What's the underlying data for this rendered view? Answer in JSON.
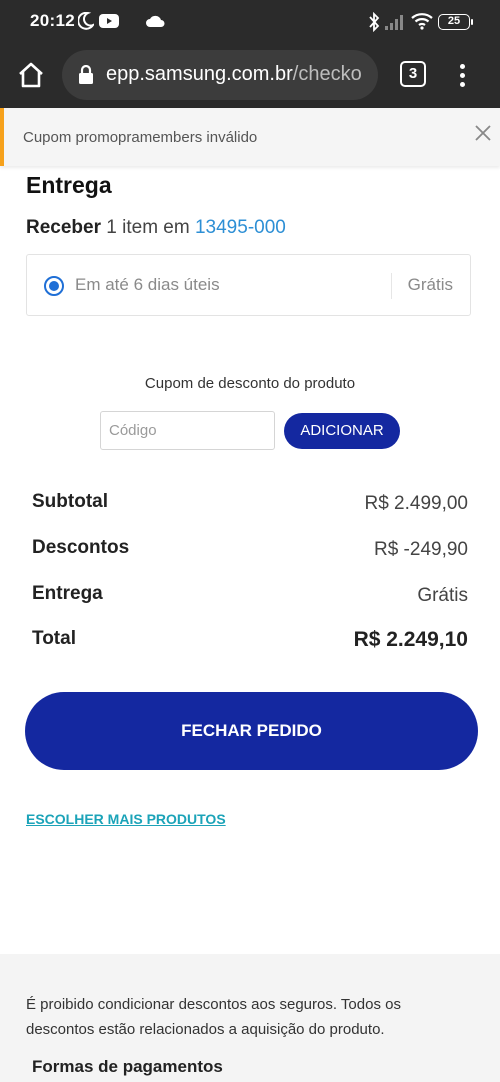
{
  "status_bar": {
    "time": "20:12",
    "battery": "25",
    "icons": [
      "moon-icon",
      "youtube-icon",
      "cloud-icon",
      "bluetooth-icon",
      "signal-icon",
      "wifi-icon",
      "battery-icon"
    ]
  },
  "browser": {
    "url_host": "epp.samsung.com.br",
    "url_path": "/checko",
    "tab_count": "3"
  },
  "alert": {
    "message": "Cupom promopramembers inválido"
  },
  "delivery": {
    "heading": "Entrega",
    "receive_label": "Receber",
    "receive_items": "1 item em",
    "zip": "13495-000",
    "option_label": "Em até 6 dias úteis",
    "option_price": "Grátis"
  },
  "coupon": {
    "title": "Cupom de desconto do produto",
    "placeholder": "Código",
    "button": "ADICIONAR"
  },
  "summary": {
    "subtotal_label": "Subtotal",
    "subtotal_value": "R$ 2.499,00",
    "discount_label": "Descontos",
    "discount_value": "R$ -249,90",
    "shipping_label": "Entrega",
    "shipping_value": "Grátis",
    "total_label": "Total",
    "total_value": "R$ 2.249,10"
  },
  "actions": {
    "checkout": "FECHAR PEDIDO",
    "more_products": "ESCOLHER MAIS PRODUTOS"
  },
  "footer": {
    "note": "É proibido condicionar descontos aos seguros. Todos os descontos estão relacionados a aquisição do produto.",
    "payments_heading": "Formas de pagamentos"
  },
  "colors": {
    "primary": "#1428a0",
    "link": "#2d8fd5",
    "alert_accent": "#f6a11b"
  }
}
